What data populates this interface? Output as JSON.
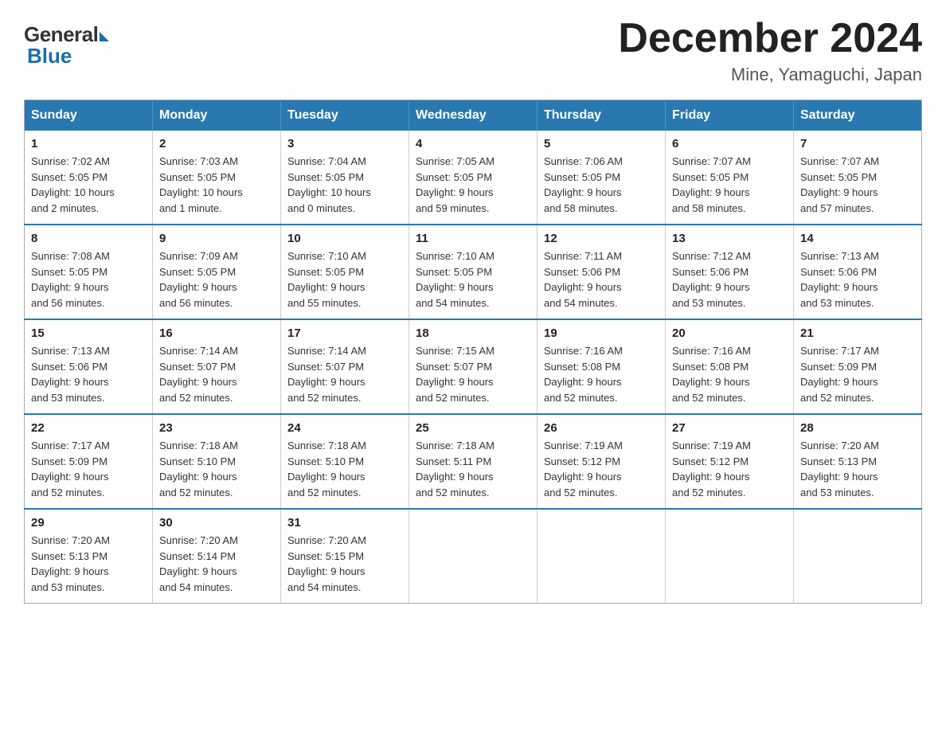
{
  "logo": {
    "general": "General",
    "blue": "Blue"
  },
  "title": "December 2024",
  "location": "Mine, Yamaguchi, Japan",
  "days_of_week": [
    "Sunday",
    "Monday",
    "Tuesday",
    "Wednesday",
    "Thursday",
    "Friday",
    "Saturday"
  ],
  "weeks": [
    [
      {
        "day": "1",
        "info": "Sunrise: 7:02 AM\nSunset: 5:05 PM\nDaylight: 10 hours\nand 2 minutes."
      },
      {
        "day": "2",
        "info": "Sunrise: 7:03 AM\nSunset: 5:05 PM\nDaylight: 10 hours\nand 1 minute."
      },
      {
        "day": "3",
        "info": "Sunrise: 7:04 AM\nSunset: 5:05 PM\nDaylight: 10 hours\nand 0 minutes."
      },
      {
        "day": "4",
        "info": "Sunrise: 7:05 AM\nSunset: 5:05 PM\nDaylight: 9 hours\nand 59 minutes."
      },
      {
        "day": "5",
        "info": "Sunrise: 7:06 AM\nSunset: 5:05 PM\nDaylight: 9 hours\nand 58 minutes."
      },
      {
        "day": "6",
        "info": "Sunrise: 7:07 AM\nSunset: 5:05 PM\nDaylight: 9 hours\nand 58 minutes."
      },
      {
        "day": "7",
        "info": "Sunrise: 7:07 AM\nSunset: 5:05 PM\nDaylight: 9 hours\nand 57 minutes."
      }
    ],
    [
      {
        "day": "8",
        "info": "Sunrise: 7:08 AM\nSunset: 5:05 PM\nDaylight: 9 hours\nand 56 minutes."
      },
      {
        "day": "9",
        "info": "Sunrise: 7:09 AM\nSunset: 5:05 PM\nDaylight: 9 hours\nand 56 minutes."
      },
      {
        "day": "10",
        "info": "Sunrise: 7:10 AM\nSunset: 5:05 PM\nDaylight: 9 hours\nand 55 minutes."
      },
      {
        "day": "11",
        "info": "Sunrise: 7:10 AM\nSunset: 5:05 PM\nDaylight: 9 hours\nand 54 minutes."
      },
      {
        "day": "12",
        "info": "Sunrise: 7:11 AM\nSunset: 5:06 PM\nDaylight: 9 hours\nand 54 minutes."
      },
      {
        "day": "13",
        "info": "Sunrise: 7:12 AM\nSunset: 5:06 PM\nDaylight: 9 hours\nand 53 minutes."
      },
      {
        "day": "14",
        "info": "Sunrise: 7:13 AM\nSunset: 5:06 PM\nDaylight: 9 hours\nand 53 minutes."
      }
    ],
    [
      {
        "day": "15",
        "info": "Sunrise: 7:13 AM\nSunset: 5:06 PM\nDaylight: 9 hours\nand 53 minutes."
      },
      {
        "day": "16",
        "info": "Sunrise: 7:14 AM\nSunset: 5:07 PM\nDaylight: 9 hours\nand 52 minutes."
      },
      {
        "day": "17",
        "info": "Sunrise: 7:14 AM\nSunset: 5:07 PM\nDaylight: 9 hours\nand 52 minutes."
      },
      {
        "day": "18",
        "info": "Sunrise: 7:15 AM\nSunset: 5:07 PM\nDaylight: 9 hours\nand 52 minutes."
      },
      {
        "day": "19",
        "info": "Sunrise: 7:16 AM\nSunset: 5:08 PM\nDaylight: 9 hours\nand 52 minutes."
      },
      {
        "day": "20",
        "info": "Sunrise: 7:16 AM\nSunset: 5:08 PM\nDaylight: 9 hours\nand 52 minutes."
      },
      {
        "day": "21",
        "info": "Sunrise: 7:17 AM\nSunset: 5:09 PM\nDaylight: 9 hours\nand 52 minutes."
      }
    ],
    [
      {
        "day": "22",
        "info": "Sunrise: 7:17 AM\nSunset: 5:09 PM\nDaylight: 9 hours\nand 52 minutes."
      },
      {
        "day": "23",
        "info": "Sunrise: 7:18 AM\nSunset: 5:10 PM\nDaylight: 9 hours\nand 52 minutes."
      },
      {
        "day": "24",
        "info": "Sunrise: 7:18 AM\nSunset: 5:10 PM\nDaylight: 9 hours\nand 52 minutes."
      },
      {
        "day": "25",
        "info": "Sunrise: 7:18 AM\nSunset: 5:11 PM\nDaylight: 9 hours\nand 52 minutes."
      },
      {
        "day": "26",
        "info": "Sunrise: 7:19 AM\nSunset: 5:12 PM\nDaylight: 9 hours\nand 52 minutes."
      },
      {
        "day": "27",
        "info": "Sunrise: 7:19 AM\nSunset: 5:12 PM\nDaylight: 9 hours\nand 52 minutes."
      },
      {
        "day": "28",
        "info": "Sunrise: 7:20 AM\nSunset: 5:13 PM\nDaylight: 9 hours\nand 53 minutes."
      }
    ],
    [
      {
        "day": "29",
        "info": "Sunrise: 7:20 AM\nSunset: 5:13 PM\nDaylight: 9 hours\nand 53 minutes."
      },
      {
        "day": "30",
        "info": "Sunrise: 7:20 AM\nSunset: 5:14 PM\nDaylight: 9 hours\nand 54 minutes."
      },
      {
        "day": "31",
        "info": "Sunrise: 7:20 AM\nSunset: 5:15 PM\nDaylight: 9 hours\nand 54 minutes."
      },
      {
        "day": "",
        "info": ""
      },
      {
        "day": "",
        "info": ""
      },
      {
        "day": "",
        "info": ""
      },
      {
        "day": "",
        "info": ""
      }
    ]
  ]
}
